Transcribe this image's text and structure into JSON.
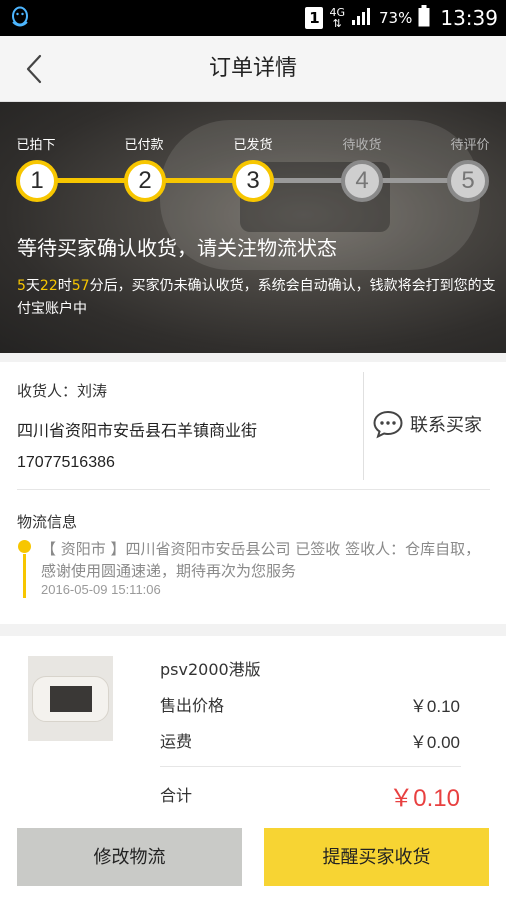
{
  "status_bar": {
    "sim": "1",
    "network": "4G",
    "battery": "73%",
    "time": "13:39",
    "icons": [
      "qq-icon",
      "sim-icon",
      "signal-icon",
      "battery-icon"
    ]
  },
  "header": {
    "title": "订单详情",
    "back_icon": "chevron-left-icon"
  },
  "progress": {
    "current_step": 3,
    "accent_color": "#f7c600",
    "steps": [
      {
        "label": "已拍下",
        "number": "1"
      },
      {
        "label": "已付款",
        "number": "2"
      },
      {
        "label": "已发货",
        "number": "3"
      },
      {
        "label": "待收货",
        "number": "4"
      },
      {
        "label": "待评价",
        "number": "5"
      }
    ]
  },
  "notice": {
    "title": "等待买家确认收货，请关注物流状态",
    "days": "5",
    "days_unit": "天",
    "hours": "22",
    "hours_unit": "时",
    "minutes": "57",
    "minutes_unit": "分后，买家仍未确认收货，系统会自动确认，钱款将会打到您的支付宝账户中"
  },
  "address": {
    "receiver": "收货人：刘涛",
    "address": "四川省资阳市安岳县石羊镇商业街",
    "phone": "17077516386",
    "contact_label": "联系买家",
    "contact_icon": "chat-bubble-icon"
  },
  "logistics": {
    "title": "物流信息",
    "text": "【 资阳市 】四川省资阳市安岳县公司 已签收 签收人：仓库自取，感谢使用圆通速递，期待再次为您服务",
    "time": "2016-05-09 15:11:06"
  },
  "product": {
    "name": "psv2000港版",
    "price_label": "售出价格",
    "price_value": "￥0.10",
    "shipping_label": "运费",
    "shipping_value": "￥0.00",
    "total_label": "合计",
    "total_value": "￥0.10",
    "total_color": "#e84040"
  },
  "actions": {
    "modify_label": "修改物流",
    "remind_label": "提醒买家收货"
  }
}
